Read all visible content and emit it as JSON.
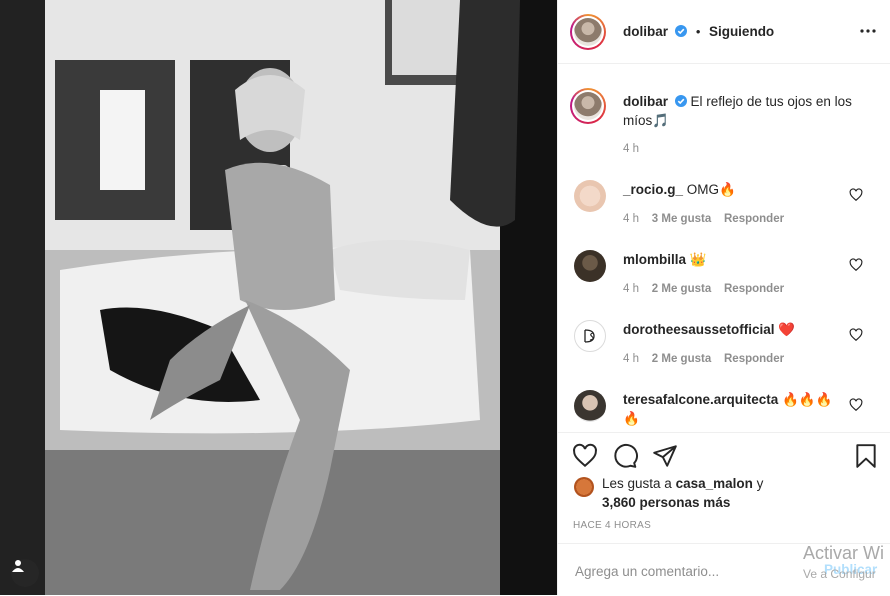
{
  "post": {
    "author": "dolibar",
    "follow_label": "Siguiendo",
    "separator": "•",
    "caption": "El reflejo de tus ojos en los míos",
    "caption_emoji": "🎵",
    "caption_time": "4 h"
  },
  "comments": [
    {
      "user": "_rocio.g_",
      "text": "OMG",
      "emoji": "🔥",
      "time": "4 h",
      "likes": "3 Me gusta",
      "reply": "Responder"
    },
    {
      "user": "mlombilla",
      "text": "",
      "emoji": "👑",
      "time": "4 h",
      "likes": "2 Me gusta",
      "reply": "Responder"
    },
    {
      "user": "dorotheesaussetofficial",
      "text": "",
      "emoji": "❤️",
      "time": "4 h",
      "likes": "2 Me gusta",
      "reply": "Responder"
    },
    {
      "user": "teresafalcone.arquitecta",
      "text": "",
      "emoji": "🔥🔥🔥 🔥",
      "time": "",
      "likes": "",
      "reply": ""
    }
  ],
  "likes": {
    "prefix": "Les gusta a",
    "user": "casa_malon",
    "joiner": "y",
    "others": "3,860 personas más"
  },
  "time_ago": "HACE 4 HORAS",
  "comment_box": {
    "placeholder": "Agrega un comentario...",
    "post_label": "Publicar"
  },
  "overlay": {
    "line1": "Activar Wi",
    "line2": "Ve a Configur"
  },
  "icons": {
    "verified": "verified-badge-icon",
    "more": "more-options-icon",
    "heart": "heart-icon",
    "comment": "comment-icon",
    "share": "share-icon",
    "save": "bookmark-icon",
    "user_tag": "user-tag-icon"
  },
  "colors": {
    "verified": "#3897f0",
    "link_disabled": "#b2dffc",
    "muted": "#8e8e8e"
  }
}
